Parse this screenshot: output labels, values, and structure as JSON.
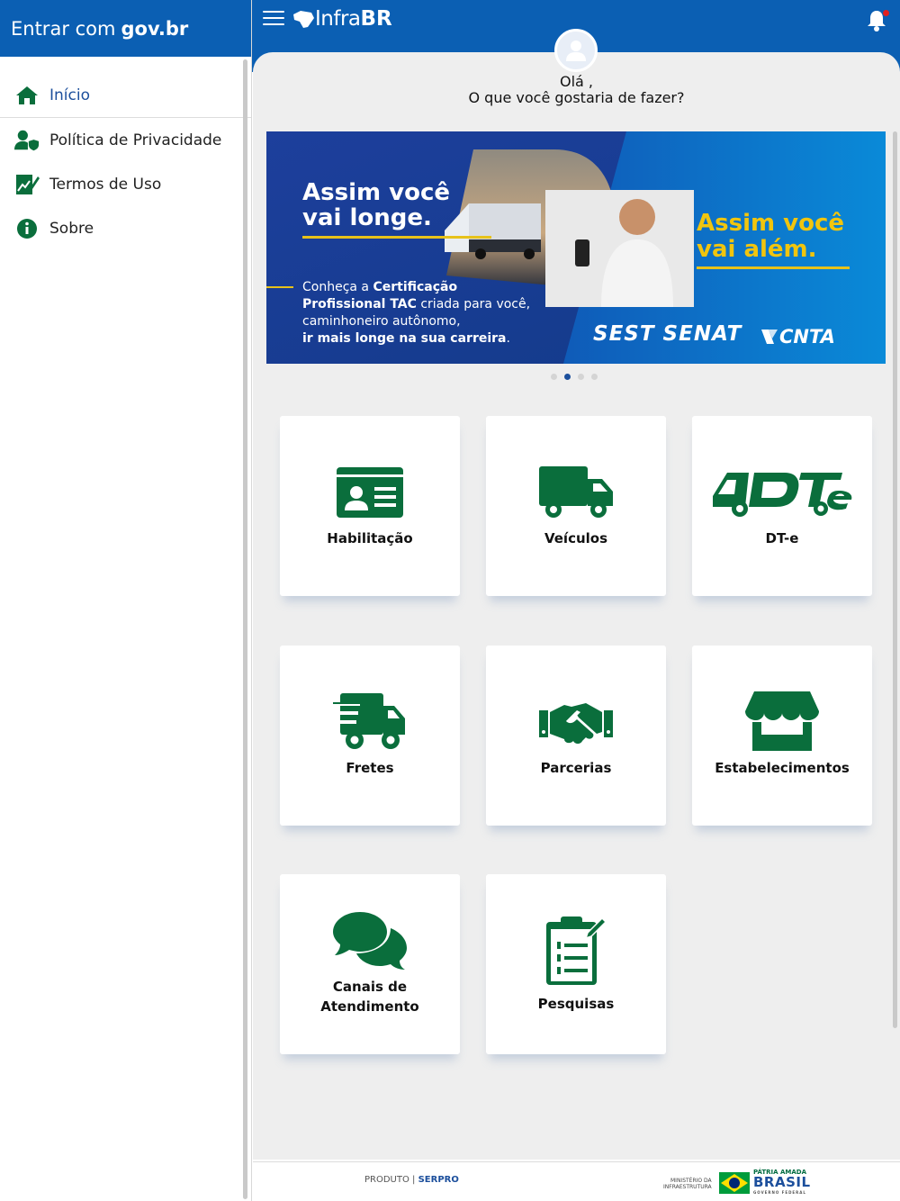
{
  "sidebar": {
    "header": {
      "prefix": "Entrar com",
      "brand": "gov.br"
    },
    "items": [
      {
        "label": "Início",
        "icon": "home-icon",
        "active": true
      },
      {
        "label": "Política de Privacidade",
        "icon": "user-shield-icon"
      },
      {
        "label": "Termos de Uso",
        "icon": "document-chart-icon"
      },
      {
        "label": "Sobre",
        "icon": "info-icon"
      }
    ]
  },
  "topbar": {
    "logo_infra": "Infra",
    "logo_br": "BR",
    "notification_badge": true
  },
  "greeting": {
    "line1": "Olá ,",
    "line2": "O que você gostaria de fazer?"
  },
  "banner": {
    "left_title_1": "Assim você",
    "left_title_2": "vai longe.",
    "text_1_a": "Conheça a ",
    "text_1_b": "Certificação",
    "text_2_a": "Profissional TAC",
    "text_2_b": " criada para você,",
    "text_3": "caminhoneiro autônomo,",
    "text_4": "ir mais longe na sua carreira",
    "text_4_end": ".",
    "right_title_1": "Assim você",
    "right_title_2": "vai além.",
    "sponsor_1": "SEST SENAT",
    "sponsor_2": "CNTA",
    "dots": 4,
    "active_dot": 1
  },
  "tiles": [
    {
      "label": "Habilitação",
      "icon": "id-card-icon"
    },
    {
      "label": "Veículos",
      "icon": "truck-icon"
    },
    {
      "label": "DT-e",
      "icon": "dte-logo-icon"
    },
    {
      "label": "Fretes",
      "icon": "shipping-fast-icon"
    },
    {
      "label": "Parcerias",
      "icon": "handshake-icon"
    },
    {
      "label": "Estabelecimentos",
      "icon": "store-icon"
    },
    {
      "label_1": "Canais de",
      "label_2": "Atendimento",
      "icon": "comments-icon"
    },
    {
      "label": "Pesquisas",
      "icon": "clipboard-list-icon"
    }
  ],
  "footer": {
    "product": "PRODUTO",
    "serpro": "SERPRO",
    "ministerio_1": "MINISTÉRIO DA",
    "ministerio_2": "INFRAESTRUTURA",
    "patria": "PÁTRIA AMADA",
    "brasil": "BRASIL",
    "governo": "GOVERNO FEDERAL"
  },
  "colors": {
    "primary_blue": "#0b5fb3",
    "icon_green": "#0a6e3c",
    "background": "#eeeeee"
  }
}
